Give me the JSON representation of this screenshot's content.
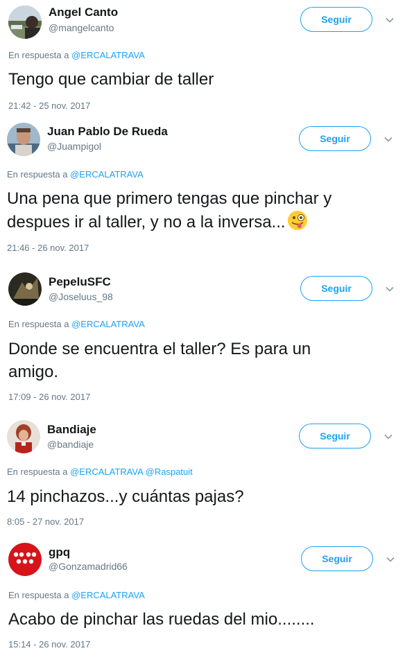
{
  "tweets": [
    {
      "name": "Angel Canto",
      "handle": "@mangelcanto",
      "follow_label": "Seguir",
      "reply_prefix": "En respuesta a",
      "reply_mentions": [
        "@ERCALATRAVA"
      ],
      "text": "Tengo que cambiar de taller",
      "timestamp": "21:42 - 25 nov. 2017"
    },
    {
      "name": "Juan Pablo De Rueda",
      "handle": "@Juampigol",
      "follow_label": "Seguir",
      "reply_prefix": "En respuesta a",
      "reply_mentions": [
        "@ERCALATRAVA"
      ],
      "text_line1": "Una pena que primero tengas que pinchar y",
      "text_line2": "despues ir al taller, y no a la inversa...",
      "emoji": "winking-face-with-tongue-emoji",
      "timestamp": "21:46 - 26 nov. 2017"
    },
    {
      "name": "PepeluSFC",
      "handle": "@Joseluus_98",
      "follow_label": "Seguir",
      "reply_prefix": "En respuesta a",
      "reply_mentions": [
        "@ERCALATRAVA"
      ],
      "text_line1": "Donde se encuentra el taller? Es para un",
      "text_line2": "amigo.",
      "timestamp": "17:09 - 26 nov. 2017"
    },
    {
      "name": "Bandiaje",
      "handle": "@bandiaje",
      "follow_label": "Seguir",
      "reply_prefix": "En respuesta a",
      "reply_mentions": [
        "@ERCALATRAVA",
        "@Raspatuit"
      ],
      "text": "14 pinchazos...y cuántas pajas?",
      "timestamp": "8:05 - 27 nov. 2017"
    },
    {
      "name": "gpq",
      "handle": "@Gonzamadrid66",
      "follow_label": "Seguir",
      "reply_prefix": "En respuesta a",
      "reply_mentions": [
        "@ERCALATRAVA"
      ],
      "text": "Acabo de pinchar las ruedas del mio........",
      "timestamp": "15:14 - 26 nov. 2017"
    }
  ],
  "colors": {
    "accent": "#1da1f2",
    "text": "#14171a",
    "secondary": "#657786"
  },
  "icons": {
    "menu": "chevron-down-icon"
  }
}
